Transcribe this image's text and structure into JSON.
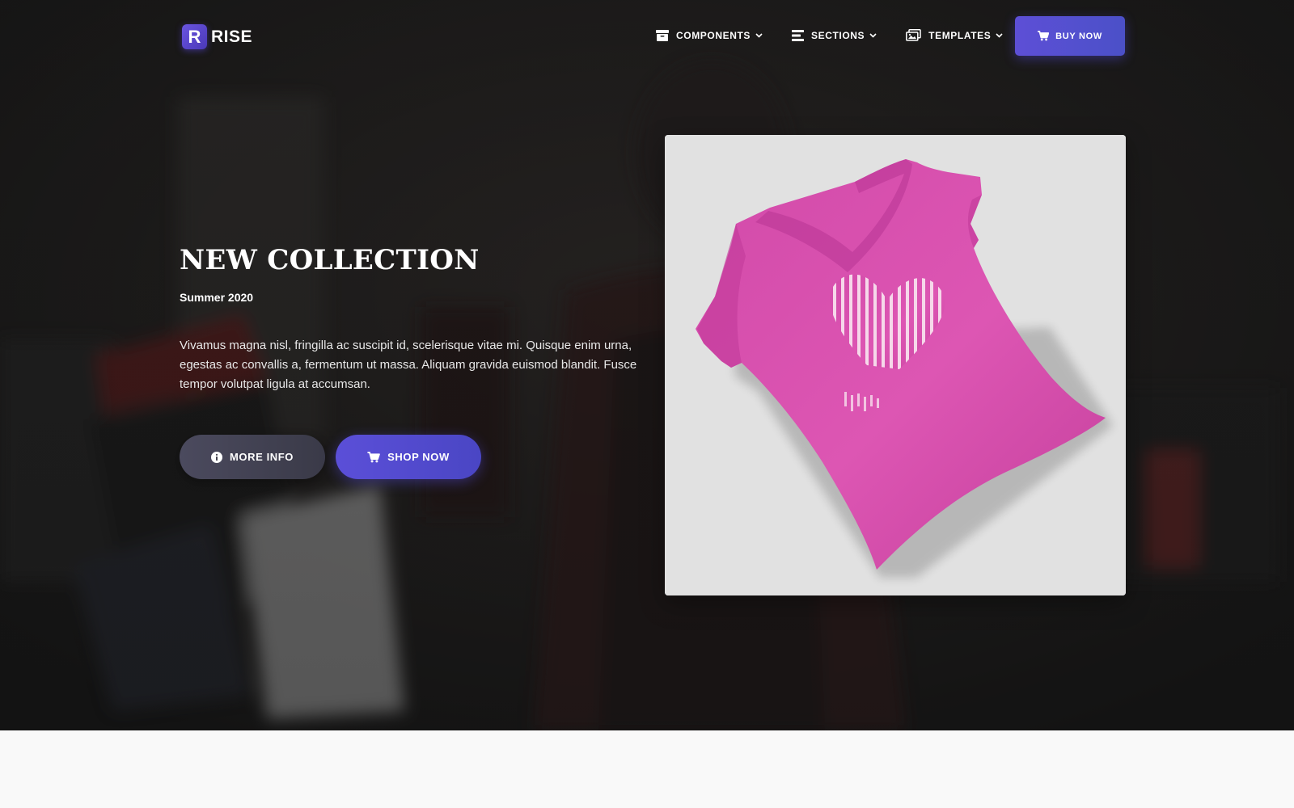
{
  "brand": {
    "mark": "R",
    "name": "RISE"
  },
  "nav": {
    "items": [
      {
        "label": "COMPONENTS",
        "icon": "archive-icon"
      },
      {
        "label": "SECTIONS",
        "icon": "list-icon"
      },
      {
        "label": "TEMPLATES",
        "icon": "images-icon"
      }
    ],
    "buy_label": "BUY NOW"
  },
  "hero": {
    "title": "NEW COLLECTION",
    "subtitle": "Summer 2020",
    "description": "Vivamus magna nisl, fringilla ac suscipit id, scelerisque vitae mi. Quisque enim urna, egestas ac convallis a, fermentum ut massa. Aliquam gravida euismod blandit. Fusce tempor volutpat ligula at accumsan.",
    "more_info_label": "MORE INFO",
    "shop_now_label": "SHOP NOW"
  },
  "product": {
    "image": "pink-v-neck-t-shirt",
    "color": "#d94fae"
  },
  "colors": {
    "accent": "#5b4fd8",
    "hero_overlay": "#151515",
    "page_bg": "#f9f9f9"
  }
}
